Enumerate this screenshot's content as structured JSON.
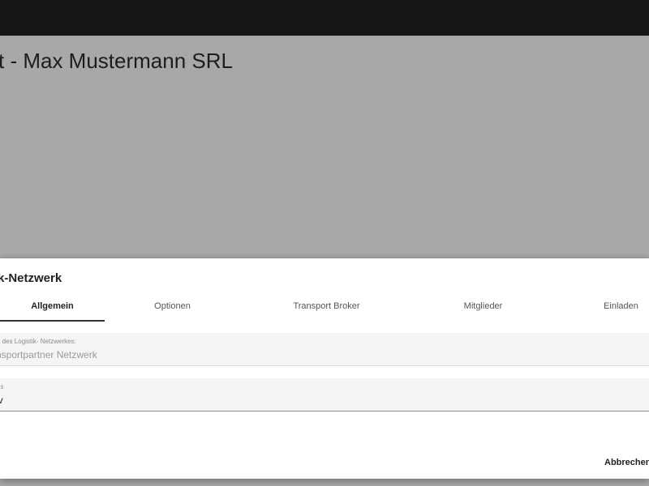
{
  "page": {
    "title": "t - Max Mustermann SRL"
  },
  "dialog": {
    "title": "k-Netzwerk",
    "tabs": [
      {
        "label": "Allgemein"
      },
      {
        "label": "Optionen"
      },
      {
        "label": "Transport Broker"
      },
      {
        "label": "Mitglieder"
      },
      {
        "label": "Einladen"
      }
    ],
    "fields": {
      "name": {
        "label": "e des Logistik- Netzwerkes:",
        "value": "nsportpartner Netzwerk"
      },
      "status": {
        "label": "us",
        "value": "iv"
      }
    },
    "cancel_label": "Abbrechen"
  }
}
